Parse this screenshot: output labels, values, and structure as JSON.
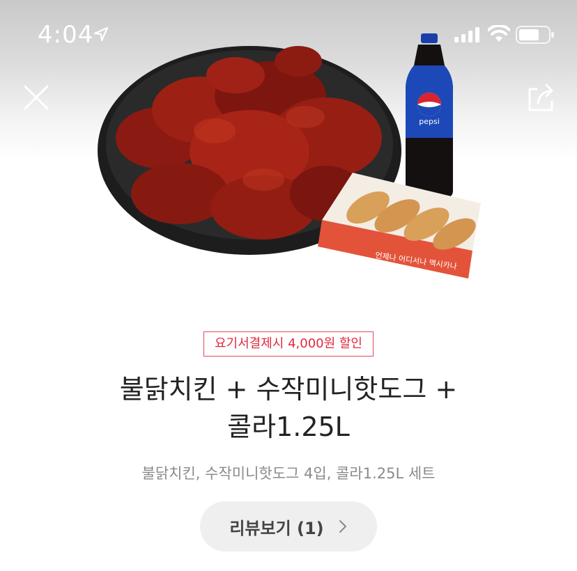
{
  "status_bar": {
    "time": "4:04"
  },
  "nav": {
    "close_icon": "close-icon",
    "share_icon": "share-icon"
  },
  "product": {
    "image_alt": "불닭치킨 + 수작미니핫도그 + 콜라1.25L",
    "discount_badge": "요기서결제시 4,000원 할인",
    "title_line1": "불닭치킨 + 수작미니핫도그 +",
    "title_line2": "콜라1.25L",
    "description": "불닭치킨, 수작미니핫도그 4입, 콜라1.25L 세트",
    "bottle_label": "pepsi",
    "box_text": "언제나 어디서나 맥시카나"
  },
  "review": {
    "label": "리뷰보기 (1)"
  },
  "colors": {
    "accent_red": "#e0283e",
    "button_bg": "#efefef"
  }
}
